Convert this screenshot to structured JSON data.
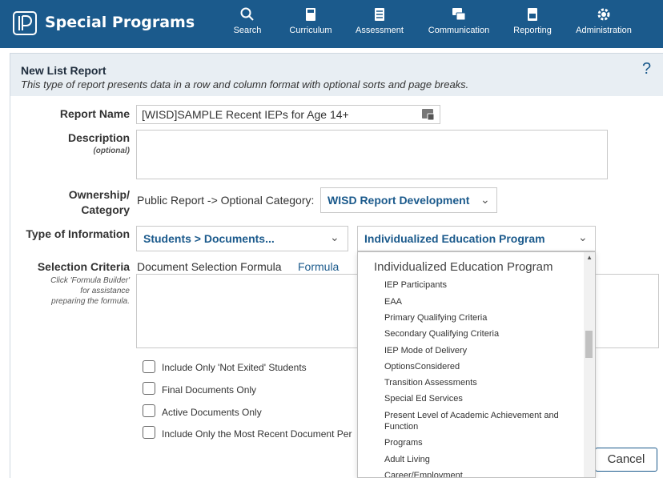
{
  "app": {
    "title": "Special Programs"
  },
  "nav": [
    {
      "label": "Search",
      "icon": "search-icon"
    },
    {
      "label": "Curriculum",
      "icon": "book-icon"
    },
    {
      "label": "Assessment",
      "icon": "checklist-icon"
    },
    {
      "label": "Communication",
      "icon": "chat-icon"
    },
    {
      "label": "Reporting",
      "icon": "report-icon"
    },
    {
      "label": "Administration",
      "icon": "gear-icon"
    }
  ],
  "header": {
    "title": "New List Report",
    "subtitle": "This type of report presents data in a row and column format with optional sorts and page breaks.",
    "help": "?"
  },
  "form": {
    "report_name_label": "Report Name",
    "report_name_value": "[WISD]SAMPLE Recent IEPs for Age 14+",
    "description_label": "Description",
    "description_optional": "(optional)",
    "ownership_label_1": "Ownership/",
    "ownership_label_2": "Category",
    "ownership_text": "Public Report -> Optional Category:",
    "category_value": "WISD Report Development",
    "type_label": "Type of Information",
    "type_value_1": "Students > Documents...",
    "type_value_2": "Individualized Education Program",
    "selection_label": "Selection Criteria",
    "selection_hint_1": "Click 'Formula Builder'",
    "selection_hint_2": "for assistance",
    "selection_hint_3": "preparing the formula.",
    "selection_text": "Document Selection Formula",
    "formula_link": "Formula"
  },
  "checkboxes": [
    {
      "label": "Include Only 'Not Exited' Students",
      "checked": false
    },
    {
      "label": "Final Documents Only",
      "checked": false
    },
    {
      "label": "Active Documents Only",
      "checked": false
    },
    {
      "label": "Include Only the Most Recent Document Per",
      "checked": false
    }
  ],
  "buttons": {
    "cancel": "Cancel"
  },
  "dropdown": {
    "header": "Individualized Education Program",
    "items": [
      "IEP Participants",
      "EAA",
      "Primary Qualifying Criteria",
      "Secondary Qualifying Criteria",
      "IEP Mode of Delivery",
      "OptionsConsidered",
      "Transition Assessments",
      "Special Ed Services",
      "Present Level of Academic Achievement and Function",
      "Programs",
      "Adult Living",
      "Career/Employment"
    ]
  },
  "colors": {
    "topbar": "#1b5a8c",
    "link": "#1b5a8c"
  }
}
